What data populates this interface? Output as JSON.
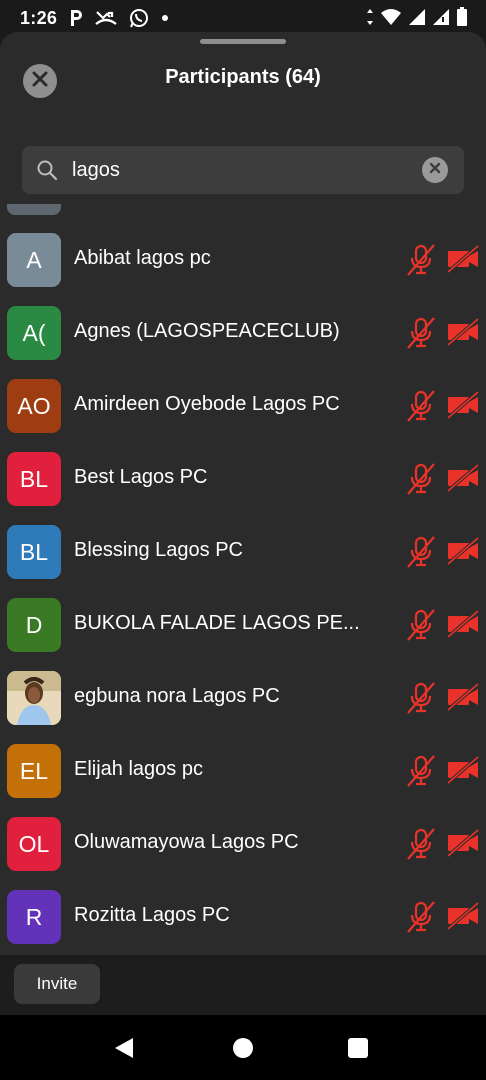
{
  "status_bar": {
    "time": "1:26",
    "left_icons": [
      "p-icon",
      "missed-call-icon",
      "whatsapp-icon",
      "dot-icon"
    ],
    "right_icons": [
      "data-arrows-icon",
      "wifi-icon",
      "signal-icon",
      "signal-icon",
      "battery-icon"
    ]
  },
  "header": {
    "title": "Participants (64)",
    "close_icon": "close-icon"
  },
  "search": {
    "value": "lagos",
    "icon": "search-icon",
    "clear_icon": "clear-icon"
  },
  "participants": [
    {
      "name": "Abibat lagos pc",
      "initials": "A",
      "color": "#7a8b98",
      "muted": true,
      "video_off": true
    },
    {
      "name": "Agnes (LAGOSPEACECLUB)",
      "initials": "A(",
      "color": "#2a8a43",
      "muted": true,
      "video_off": true
    },
    {
      "name": "Amirdeen Oyebode Lagos PC",
      "initials": "AO",
      "color": "#9e3d12",
      "muted": true,
      "video_off": true
    },
    {
      "name": "Best Lagos PC",
      "initials": "BL",
      "color": "#e0203c",
      "muted": true,
      "video_off": true
    },
    {
      "name": "Blessing Lagos PC",
      "initials": "BL",
      "color": "#2f7ab8",
      "muted": true,
      "video_off": true
    },
    {
      "name": "BUKOLA FALADE LAGOS PE...",
      "initials": "D",
      "color": "#3a7a24",
      "muted": true,
      "video_off": true
    },
    {
      "name": "egbuna nora Lagos PC",
      "initials": "",
      "color": "#c7b08a",
      "photo": true,
      "muted": true,
      "video_off": true
    },
    {
      "name": "Elijah lagos pc",
      "initials": "EL",
      "color": "#c37008",
      "muted": true,
      "video_off": true
    },
    {
      "name": "Oluwamayowa Lagos PC",
      "initials": "OL",
      "color": "#e0203c",
      "muted": true,
      "video_off": true
    },
    {
      "name": "Rozitta Lagos PC",
      "initials": "R",
      "color": "#6232b8",
      "muted": true,
      "video_off": true
    }
  ],
  "footer": {
    "invite_label": "Invite"
  },
  "colors": {
    "muted_red": "#e8322a",
    "sheet_bg": "#2b2b2b"
  }
}
